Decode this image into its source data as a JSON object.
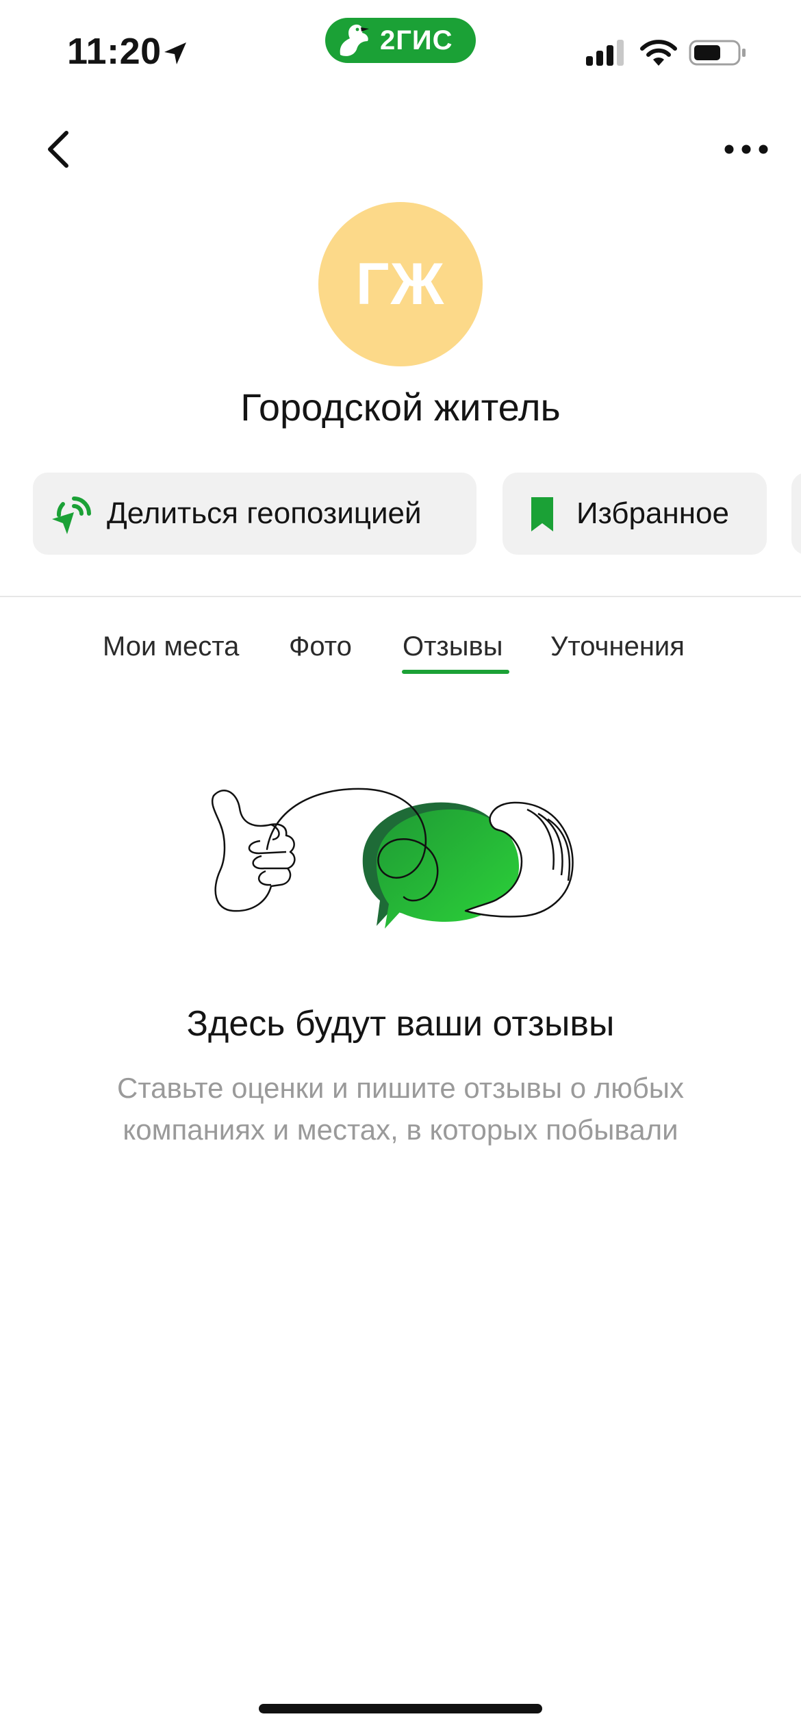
{
  "status_bar": {
    "time": "11:20",
    "brand": "2ГИС",
    "brand_color": "#1ba136",
    "icons": [
      "location-arrow-icon",
      "cellular-signal-icon",
      "wifi-icon",
      "battery-icon"
    ]
  },
  "nav": {
    "back_icon": "chevron-left-icon",
    "more_icon": "more-dots-icon"
  },
  "profile": {
    "initials": "ГЖ",
    "name": "Городской житель",
    "avatar_color": "#fcd989"
  },
  "actions": [
    {
      "label": "Делиться геопозицией",
      "icon": "share-location-icon"
    },
    {
      "label": "Избранное",
      "icon": "bookmark-icon"
    }
  ],
  "tabs": [
    {
      "label": "Мои места",
      "active": false
    },
    {
      "label": "Фото",
      "active": false
    },
    {
      "label": "Отзывы",
      "active": true
    },
    {
      "label": "Уточнения",
      "active": false
    }
  ],
  "empty_state": {
    "illustration_icon": "reviews-hands-illustration",
    "title": "Здесь будут ваши отзывы",
    "description": "Ставьте оценки и пишите отзывы о любых компаниях и местах, в которых побывали"
  },
  "accent_color": "#1ba136"
}
